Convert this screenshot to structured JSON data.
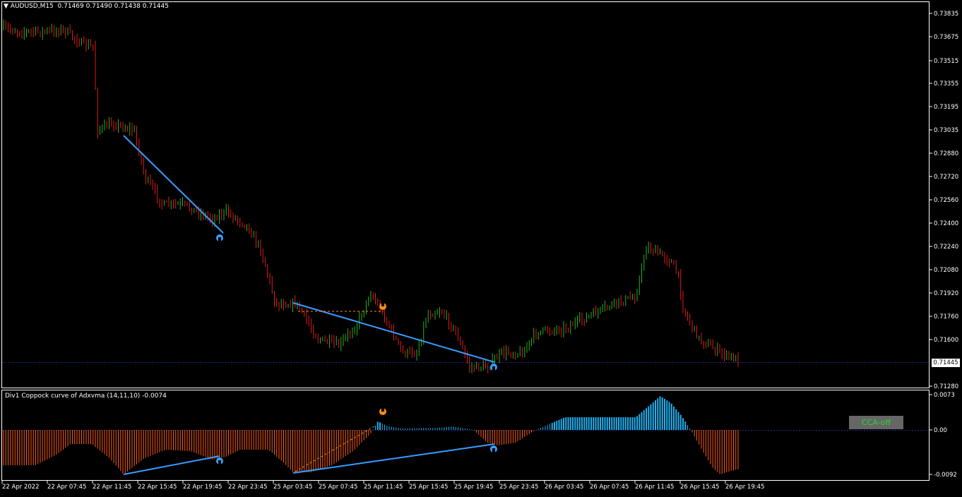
{
  "main": {
    "symbol": "AUDUSD,M15",
    "ohlc": "0.71469 0.71490 0.71438 0.71445",
    "current_price": "0.71445",
    "price_axis": [
      "0.73835",
      "0.73675",
      "0.73515",
      "0.73355",
      "0.73195",
      "0.73035",
      "0.72880",
      "0.72720",
      "0.72560",
      "0.72400",
      "0.72240",
      "0.72080",
      "0.71920",
      "0.71760",
      "0.71600",
      "0.71280"
    ]
  },
  "sub": {
    "title": "Div1 Coppock curve of Adxvma  (14,11,10) -0.0074",
    "axis": [
      "0.0073",
      "0.00",
      "-0.0092"
    ],
    "button_label": "CCA-off"
  },
  "time_axis": [
    "22 Apr 2022",
    "22 Apr 07:45",
    "22 Apr 11:45",
    "22 Apr 15:45",
    "22 Apr 19:45",
    "22 Apr 23:45",
    "25 Apr 03:45",
    "25 Apr 07:45",
    "25 Apr 11:45",
    "25 Apr 15:45",
    "25 Apr 19:45",
    "25 Apr 23:45",
    "26 Apr 03:45",
    "26 Apr 07:45",
    "26 Apr 11:45",
    "26 Apr 15:45",
    "26 Apr 19:45"
  ],
  "colors": {
    "bull": "#22b422",
    "bear": "#e01a1a",
    "hist_neg": "#ff5a14",
    "hist_pos": "#20b0f0",
    "div_line": "#3a9cff",
    "marker_bear": "#ff8c1a",
    "grid_line": "#1e2a8c"
  },
  "chart_data": [
    {
      "type": "line",
      "title": "AUDUSD,M15",
      "x": [
        "22 Apr 2022",
        "22 Apr 07:45",
        "22 Apr 11:45",
        "22 Apr 15:45",
        "22 Apr 19:45",
        "22 Apr 23:45",
        "25 Apr 03:45",
        "25 Apr 07:45",
        "25 Apr 11:45",
        "25 Apr 15:45",
        "25 Apr 19:45",
        "25 Apr 23:45",
        "26 Apr 03:45",
        "26 Apr 07:45",
        "26 Apr 11:45",
        "26 Apr 15:45",
        "26 Apr 19:45"
      ],
      "series": [
        {
          "values": [
            0.7374,
            0.7372,
            0.7305,
            0.7263,
            0.7247,
            0.723,
            0.718,
            0.7155,
            0.7185,
            0.717,
            0.7145,
            0.715,
            0.7168,
            0.7178,
            0.7224,
            0.7158,
            0.7145
          ]
        }
      ],
      "ylim": [
        0.7128,
        0.7388
      ]
    },
    {
      "type": "bar",
      "title": "Div1 Coppock curve of Adxvma  (14,11,10) -0.0074",
      "x": [
        "22 Apr 2022",
        "22 Apr 07:45",
        "22 Apr 11:45",
        "22 Apr 15:45",
        "22 Apr 19:45",
        "22 Apr 23:45",
        "25 Apr 03:45",
        "25 Apr 07:45",
        "25 Apr 11:45",
        "25 Apr 15:45",
        "25 Apr 19:45",
        "25 Apr 23:45",
        "26 Apr 03:45",
        "26 Apr 07:45",
        "26 Apr 11:45",
        "26 Apr 15:45",
        "26 Apr 19:45"
      ],
      "series": [
        {
          "values": [
            -0.006,
            -0.0035,
            -0.009,
            -0.0035,
            -0.0055,
            -0.004,
            -0.009,
            -0.005,
            0.0018,
            0.0006,
            -0.0035,
            0.0015,
            0.0035,
            0.0028,
            0.0075,
            -0.0085,
            -0.0074
          ]
        }
      ],
      "ylim": [
        -0.0095,
        0.0077
      ]
    }
  ]
}
